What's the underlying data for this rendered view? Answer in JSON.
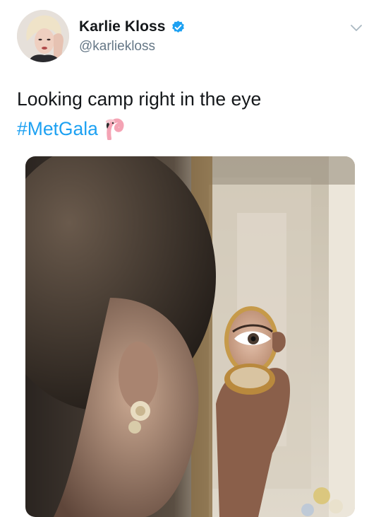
{
  "tweet": {
    "display_name": "Karlie Kloss",
    "handle": "@karliekloss",
    "text": "Looking camp right in the eye",
    "hashtag": "#MetGala",
    "verified": true
  },
  "icons": {
    "verified": "verified-badge-icon",
    "more": "chevron-down-icon",
    "emoji": "flamingo-emoji"
  },
  "colors": {
    "link": "#1da1f2",
    "secondary_text": "#657786",
    "verified_badge": "#1da1f2"
  }
}
